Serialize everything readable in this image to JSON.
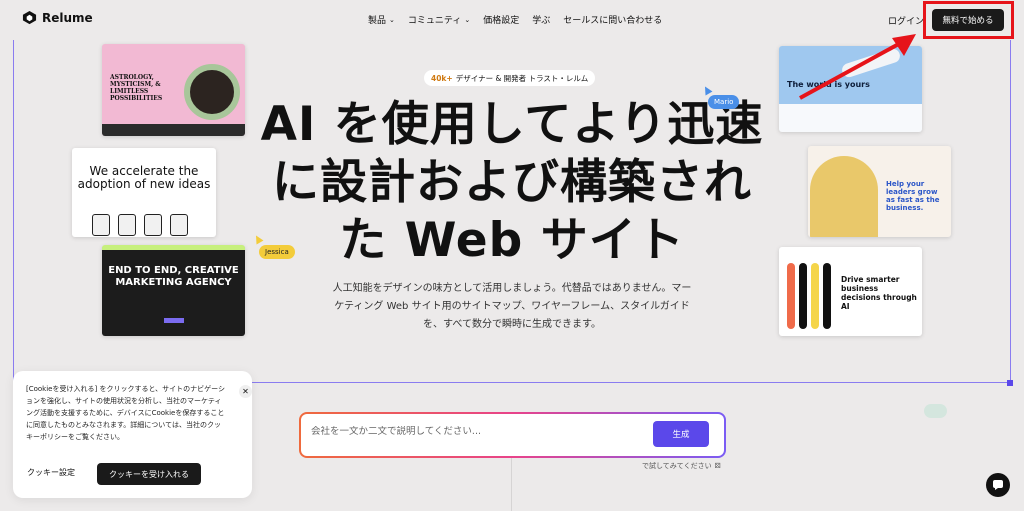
{
  "nav": {
    "brand": "Relume",
    "menu": [
      {
        "label": "製品",
        "has_dropdown": true
      },
      {
        "label": "コミュニティ",
        "has_dropdown": true
      },
      {
        "label": "価格設定",
        "has_dropdown": false
      },
      {
        "label": "学ぶ",
        "has_dropdown": false
      },
      {
        "label": "セールスに問い合わせる",
        "has_dropdown": false
      }
    ],
    "login": "ログイン",
    "cta": "無料で始める"
  },
  "hero": {
    "badge_count": "40k+",
    "badge_text": "デザイナー & 開発者 トラスト・レルム",
    "headline_line1": "AI を使用してより迅速",
    "headline_line2": "に設計および構築され",
    "headline_line3": "た Web サイト",
    "subtext_line1": "人工知能をデザインの味方として活用しましょう。代替品ではありません。マー",
    "subtext_line2": "ケティング Web サイト用のサイトマップ、ワイヤーフレーム、スタイルガイド",
    "subtext_line3": "を、すべて数分で瞬時に生成できます。"
  },
  "cursors": {
    "mario": "Mario",
    "jessica": "Jessica"
  },
  "thumbnails": {
    "astrology": "ASTROLOGY, MYSTICISM, & LIMITLESS POSSIBILITIES",
    "accelerate": "We accelerate the adoption of new ideas",
    "agency": "END TO END, CREATIVE MARKETING AGENCY",
    "travel": "The world is yours",
    "leaders": "Help your leaders grow as fast as the business.",
    "decisions": "Drive smarter business decisions through AI"
  },
  "cookie": {
    "text": "[Cookieを受け入れる] をクリックすると、サイトのナビゲーションを強化し、サイトの使用状況を分析し、当社のマーケティング活動を支援するために、デバイスにCookieを保存することに同意したものとみなされます。詳細については、当社のクッキーポリシーをご覧ください。",
    "settings": "クッキー設定",
    "accept": "クッキーを受け入れる"
  },
  "prompt": {
    "placeholder": "会社を一文か二文で説明してください...",
    "generate": "生成",
    "try_text": "で試してみてください"
  },
  "colors": {
    "accent": "#5b48ea",
    "highlight_red": "#e6141a",
    "background": "#eceaea"
  }
}
